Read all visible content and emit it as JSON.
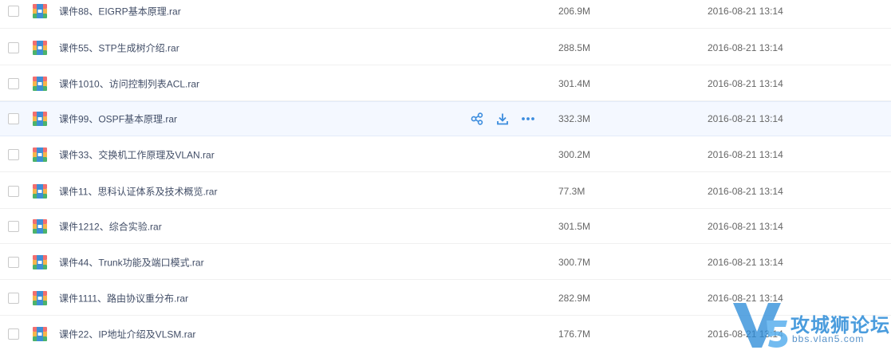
{
  "colors": {
    "accent": "#3b8cde",
    "row_hover": "#f4f8ff",
    "text_name": "#424e67",
    "text_meta": "#666666"
  },
  "file_icon": "rar-archive-icon",
  "hover_actions": [
    {
      "icon": "share-icon"
    },
    {
      "icon": "download-icon"
    },
    {
      "icon": "more-icon"
    }
  ],
  "files": [
    {
      "name": "课件88、EIGRP基本原理.rar",
      "size": "206.9M",
      "modified": "2016-08-21 13:14"
    },
    {
      "name": "课件55、STP生成树介绍.rar",
      "size": "288.5M",
      "modified": "2016-08-21 13:14"
    },
    {
      "name": "课件1010、访问控制列表ACL.rar",
      "size": "301.4M",
      "modified": "2016-08-21 13:14"
    },
    {
      "name": "课件99、OSPF基本原理.rar",
      "size": "332.3M",
      "modified": "2016-08-21 13:14",
      "hovered": true
    },
    {
      "name": "课件33、交换机工作原理及VLAN.rar",
      "size": "300.2M",
      "modified": "2016-08-21 13:14"
    },
    {
      "name": "课件11、思科认证体系及技术概览.rar",
      "size": "77.3M",
      "modified": "2016-08-21 13:14"
    },
    {
      "name": "课件1212、综合实验.rar",
      "size": "301.5M",
      "modified": "2016-08-21 13:14"
    },
    {
      "name": "课件44、Trunk功能及端口模式.rar",
      "size": "300.7M",
      "modified": "2016-08-21 13:14"
    },
    {
      "name": "课件1111、路由协议重分布.rar",
      "size": "282.9M",
      "modified": "2016-08-21 13:14"
    },
    {
      "name": "课件22、IP地址介绍及VLSM.rar",
      "size": "176.7M",
      "modified": "2016-08-21 13:14"
    }
  ],
  "watermark": {
    "title": "攻城狮论坛",
    "url": "bbs.vlan5.com"
  }
}
